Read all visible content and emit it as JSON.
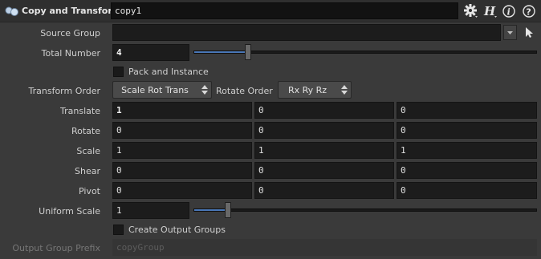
{
  "header": {
    "node_type": "Copy and Transform",
    "node_name": "copy1",
    "gear_icon": "gear-icon",
    "help_icons": [
      "houdini-h-icon",
      "info-icon",
      "help-icon"
    ]
  },
  "params": {
    "source_group": {
      "label": "Source Group",
      "value": ""
    },
    "total_number": {
      "label": "Total Number",
      "value": "4",
      "slider_fraction": 0.16
    },
    "pack_instance": {
      "label": "Pack and Instance",
      "checked": false
    },
    "transform_order": {
      "label": "Transform Order",
      "value": "Scale Rot Trans"
    },
    "rotate_order": {
      "label": "Rotate Order",
      "value": "Rx Ry Rz"
    },
    "translate": {
      "label": "Translate",
      "values": [
        "1",
        "0",
        "0"
      ]
    },
    "rotate": {
      "label": "Rotate",
      "values": [
        "0",
        "0",
        "0"
      ]
    },
    "scale": {
      "label": "Scale",
      "values": [
        "1",
        "1",
        "1"
      ]
    },
    "shear": {
      "label": "Shear",
      "values": [
        "0",
        "0",
        "0"
      ]
    },
    "pivot": {
      "label": "Pivot",
      "values": [
        "0",
        "0",
        "0"
      ]
    },
    "uniform_scale": {
      "label": "Uniform Scale",
      "value": "1",
      "slider_fraction": 0.1
    },
    "create_output_groups": {
      "label": "Create Output Groups",
      "checked": false
    },
    "output_group_prefix": {
      "label": "Output Group Prefix",
      "value": "copyGroup"
    }
  },
  "colors": {
    "background": "#3a3a3a",
    "field": "#1c1c1c",
    "slider_fill": "#4a78b8"
  }
}
